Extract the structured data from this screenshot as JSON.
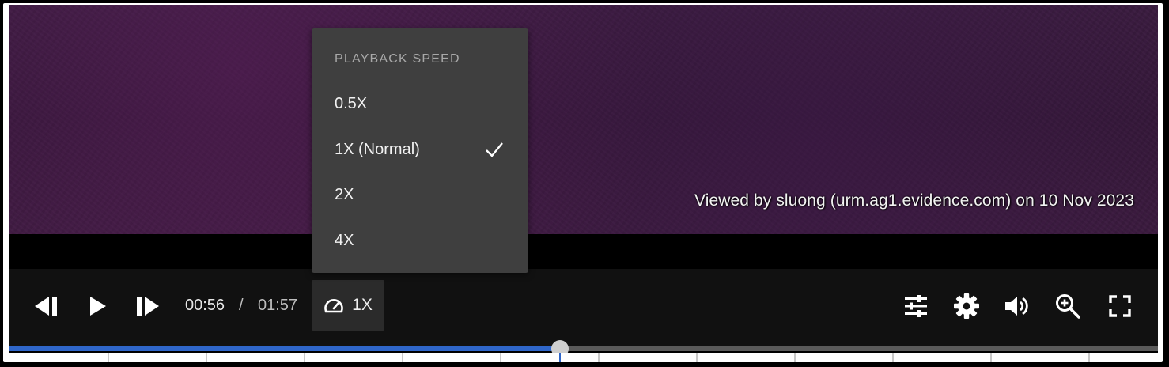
{
  "video": {
    "watermark": "Viewed by sluong (urm.ag1.evidence.com) on 10 Nov 2023",
    "background_color": "#361a3b"
  },
  "controls": {
    "time_current": "00:56",
    "time_separator": "/",
    "time_total": "01:57",
    "speed_label": "1X",
    "icons": [
      "skip-back-icon",
      "play-icon",
      "skip-forward-icon",
      "speedometer-icon",
      "adjustments-icon",
      "gear-icon",
      "volume-icon",
      "zoom-in-icon",
      "fullscreen-icon"
    ]
  },
  "speed_menu": {
    "title": "PLAYBACK SPEED",
    "options": [
      {
        "label": "0.5X",
        "selected": false
      },
      {
        "label": "1X (Normal)",
        "selected": true
      },
      {
        "label": "2X",
        "selected": false
      },
      {
        "label": "4X",
        "selected": false
      }
    ]
  },
  "progress": {
    "fraction": 0.479,
    "fill_color": "#2f66c9"
  }
}
